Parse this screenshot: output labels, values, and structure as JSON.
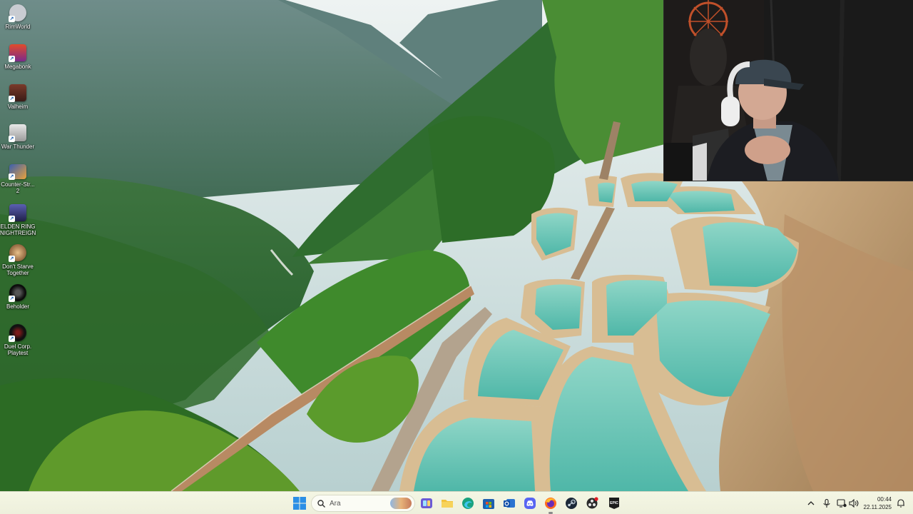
{
  "desktop": {
    "icons": [
      {
        "label": "RimWorld",
        "icon": "rimworld-icon",
        "color": "#c9ccd2"
      },
      {
        "label": "Megabonk",
        "icon": "megabonk-icon",
        "color": "#e14b2b"
      },
      {
        "label": "Valheim",
        "icon": "valheim-icon",
        "color": "#5b2d22"
      },
      {
        "label": "War Thunder",
        "icon": "war-thunder-icon",
        "color": "#d7d7d7"
      },
      {
        "label": "Counter-Str...\n2",
        "icon": "counter-strike-icon",
        "color": "#e9a23b"
      },
      {
        "label": "ELDEN RING\nNIGHTREIGN",
        "icon": "elden-ring-icon",
        "color": "#3b3f7a"
      },
      {
        "label": "Don't Starve\nTogether",
        "icon": "dont-starve-icon",
        "color": "#b07a45"
      },
      {
        "label": "Beholder",
        "icon": "beholder-icon",
        "color": "#101010"
      },
      {
        "label": "Duel Corp.\nPlaytest",
        "icon": "duel-corp-icon",
        "color": "#1a1a1a"
      }
    ]
  },
  "webcam": {
    "label": "webcam-feed"
  },
  "taskbar": {
    "search_placeholder": "Ara",
    "apps": [
      {
        "name": "task-view",
        "icon": "task-view-icon",
        "color": "#6b5bd6"
      },
      {
        "name": "file-explorer",
        "icon": "folder-icon",
        "color": "#f3c23c"
      },
      {
        "name": "edge",
        "icon": "edge-icon",
        "color": "#1aa27e"
      },
      {
        "name": "calculator",
        "icon": "store-icon",
        "color": "#1f5faf"
      },
      {
        "name": "outlook",
        "icon": "outlook-icon",
        "color": "#2b74d1"
      },
      {
        "name": "discord",
        "icon": "discord-icon",
        "color": "#5865f2"
      },
      {
        "name": "firefox",
        "icon": "firefox-icon",
        "color": "#ff6a1f"
      },
      {
        "name": "steam",
        "icon": "steam-icon",
        "color": "#1b2838"
      },
      {
        "name": "obs",
        "icon": "obs-icon",
        "color": "#2b2b2b"
      },
      {
        "name": "epic-games",
        "icon": "epic-games-icon",
        "color": "#1c1c1c"
      }
    ],
    "time": "00:44",
    "date": "22.11.2025"
  }
}
